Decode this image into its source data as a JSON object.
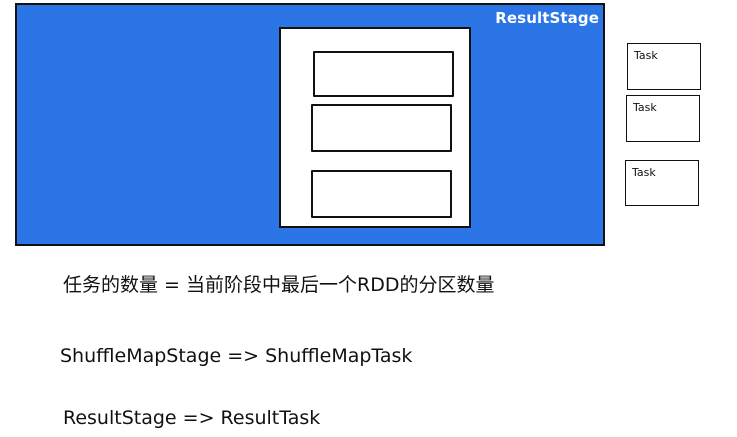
{
  "diagram": {
    "stage_label": "ResultStage",
    "tasks": [
      "Task",
      "Task",
      "Task"
    ],
    "formula": "任务的数量 = 当前阶段中最后一个RDD的分区数量",
    "mapping_1": "ShuffleMapStage => ShuffleMapTask",
    "mapping_2": "ResultStage => ResultTask"
  },
  "colors": {
    "stage_fill": "#2c75e6",
    "stage_text": "#ffffff",
    "stroke": "#111111"
  }
}
